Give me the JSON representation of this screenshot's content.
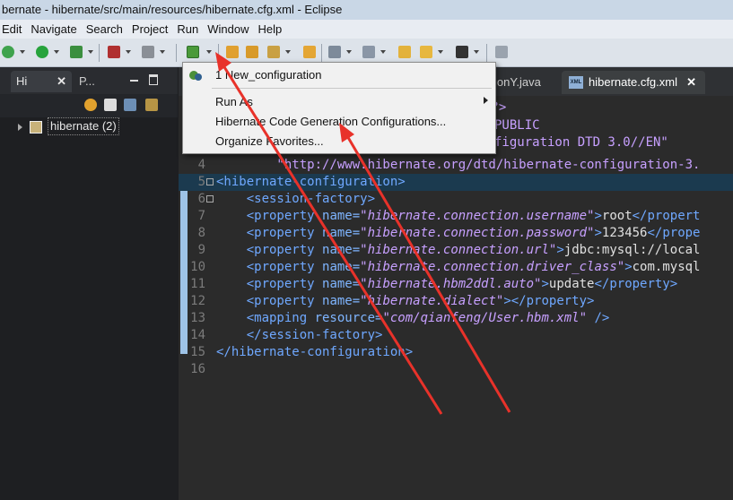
{
  "window": {
    "title": "bernate - hibernate/src/main/resources/hibernate.cfg.xml - Eclipse"
  },
  "menubar": [
    "Edit",
    "Navigate",
    "Search",
    "Project",
    "Run",
    "Window",
    "Help"
  ],
  "left_panel": {
    "tabs": [
      {
        "label": "Hi"
      },
      {
        "label": "P..."
      }
    ],
    "tree_item": "hibernate (2)"
  },
  "editor": {
    "tabs": [
      {
        "label": "ionY.java"
      },
      {
        "label": "hibernate.cfg.xml",
        "active": true
      }
    ],
    "tab_icon_text": "XML",
    "hidden_fragments": [
      "\"?>",
      "PUBLIC",
      "figuration DTD 3.0//EN\""
    ],
    "lines": [
      {
        "num": "4",
        "parts": [
          {
            "c": "s",
            "t": "        \"http://www.hibernate.org/dtd/hibernate-configuration-3."
          }
        ]
      },
      {
        "num": "5",
        "fold": true,
        "hl": true,
        "parts": [
          {
            "c": "t",
            "t": "<hibernate-configuration>"
          }
        ]
      },
      {
        "num": "6",
        "fold": true,
        "parts": [
          {
            "c": "tx",
            "t": "    "
          },
          {
            "c": "t",
            "t": "<session-factory>"
          }
        ]
      },
      {
        "num": "7",
        "parts": [
          {
            "c": "tx",
            "t": "    "
          },
          {
            "c": "t",
            "t": "<property "
          },
          {
            "c": "a",
            "t": "name="
          },
          {
            "c": "v",
            "t": "\"hibernate.connection.username\""
          },
          {
            "c": "t",
            "t": ">"
          },
          {
            "c": "tx",
            "t": "root"
          },
          {
            "c": "t",
            "t": "</propert"
          }
        ]
      },
      {
        "num": "8",
        "parts": [
          {
            "c": "tx",
            "t": "    "
          },
          {
            "c": "t",
            "t": "<property "
          },
          {
            "c": "a",
            "t": "name="
          },
          {
            "c": "v",
            "t": "\"hibernate.connection.password\""
          },
          {
            "c": "t",
            "t": ">"
          },
          {
            "c": "tx",
            "t": "123456"
          },
          {
            "c": "t",
            "t": "</prope"
          }
        ]
      },
      {
        "num": "9",
        "parts": [
          {
            "c": "tx",
            "t": "    "
          },
          {
            "c": "t",
            "t": "<property "
          },
          {
            "c": "a",
            "t": "name="
          },
          {
            "c": "v",
            "t": "\"hibernate.connection.url\""
          },
          {
            "c": "t",
            "t": ">"
          },
          {
            "c": "tx",
            "t": "jdbc:mysql://local"
          }
        ]
      },
      {
        "num": "10",
        "parts": [
          {
            "c": "tx",
            "t": "    "
          },
          {
            "c": "t",
            "t": "<property "
          },
          {
            "c": "a",
            "t": "name="
          },
          {
            "c": "v",
            "t": "\"hibernate.connection.driver_class\""
          },
          {
            "c": "t",
            "t": ">"
          },
          {
            "c": "tx",
            "t": "com.mysql"
          }
        ]
      },
      {
        "num": "11",
        "parts": [
          {
            "c": "tx",
            "t": "    "
          },
          {
            "c": "t",
            "t": "<property "
          },
          {
            "c": "a",
            "t": "name="
          },
          {
            "c": "v",
            "t": "\"hibernate.hbm2ddl.auto\""
          },
          {
            "c": "t",
            "t": ">"
          },
          {
            "c": "tx",
            "t": "update"
          },
          {
            "c": "t",
            "t": "</property>"
          }
        ]
      },
      {
        "num": "12",
        "parts": [
          {
            "c": "tx",
            "t": "    "
          },
          {
            "c": "t",
            "t": "<property "
          },
          {
            "c": "a",
            "t": "name="
          },
          {
            "c": "v",
            "t": "\"hibernate.dialect\""
          },
          {
            "c": "t",
            "t": "></property>"
          }
        ]
      },
      {
        "num": "13",
        "parts": [
          {
            "c": "tx",
            "t": "    "
          },
          {
            "c": "t",
            "t": "<mapping "
          },
          {
            "c": "a",
            "t": "resource="
          },
          {
            "c": "v",
            "t": "\"com/qianfeng/User.hbm.xml\""
          },
          {
            "c": "t",
            "t": " />"
          }
        ]
      },
      {
        "num": "14",
        "parts": [
          {
            "c": "tx",
            "t": "    "
          },
          {
            "c": "t",
            "t": "</session-factory>"
          }
        ]
      },
      {
        "num": "15",
        "parts": [
          {
            "c": "t",
            "t": "</hibernate-configuration>"
          }
        ]
      },
      {
        "num": "16",
        "parts": []
      }
    ]
  },
  "popup_menu": {
    "items": [
      {
        "label": "1 New_configuration"
      },
      {
        "label": "Run As",
        "submenu": true
      },
      {
        "label": "Hibernate Code Generation Configurations..."
      },
      {
        "label": "Organize Favorites..."
      }
    ]
  },
  "colors": {
    "annotation_arrow": "#e8322a",
    "tag": "#6fa8ff",
    "string": "#c7a0ff"
  }
}
